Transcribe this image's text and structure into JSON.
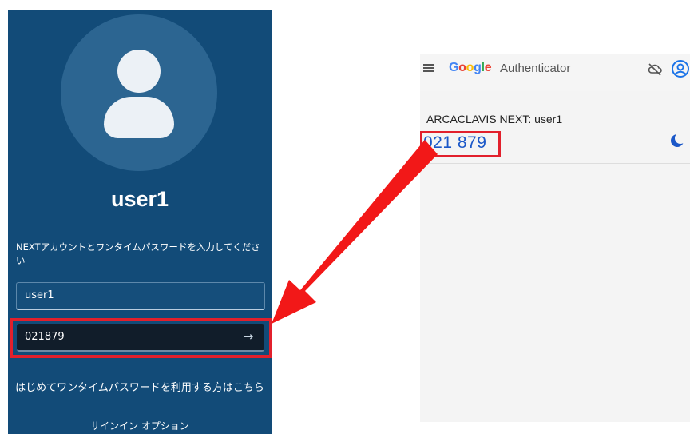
{
  "signin": {
    "username": "user1",
    "instruction": "NEXTアカウントとワンタイムパスワードを入力してください",
    "username_field_value": "user1",
    "otp_field_value": "021879",
    "submit_icon": "→",
    "first_time_link": "はじめてワンタイムパスワードを利用する方はこちら",
    "signin_options": "サインイン オプション"
  },
  "authenticator": {
    "logo": "Google",
    "app_title": "Authenticator",
    "account_label": "ARCACLAVIS NEXT: user1",
    "otp_code": "021 879"
  },
  "icons": {
    "avatar": "user-avatar-icon",
    "submit": "arrow-right-icon",
    "menu": "hamburger-menu-icon",
    "sync": "cloud-off-icon",
    "account": "account-circle-icon",
    "timer": "countdown-timer-icon"
  },
  "colors": {
    "signin_background": "#124b78",
    "highlight": "#e2202c",
    "otp_code": "#1a57c8"
  }
}
